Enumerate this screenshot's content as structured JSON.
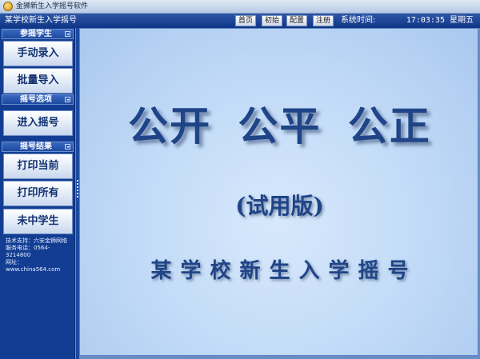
{
  "window": {
    "title": "金狮新生入学摇号软件",
    "icon": "app-logo-icon"
  },
  "header": {
    "app_title": "某学校新生入学摇号",
    "nav": [
      {
        "label": "首页"
      },
      {
        "label": "初始"
      },
      {
        "label": "配置"
      },
      {
        "label": "注册"
      }
    ],
    "system_time_label": "系统时间:",
    "clock": "17:03:35 星期五"
  },
  "sidebar": {
    "sections": [
      {
        "title": "参摇学生",
        "items": [
          {
            "label": "手动录入"
          },
          {
            "label": "批量导入"
          }
        ]
      },
      {
        "title": "摇号选项",
        "items": [
          {
            "label": "进入摇号"
          }
        ]
      },
      {
        "title": "摇号结果",
        "items": [
          {
            "label": "打印当前"
          },
          {
            "label": "打印所有"
          },
          {
            "label": "未中学生"
          }
        ]
      }
    ],
    "support": {
      "tech": "技术支持：六安金狮网络",
      "phone": "服务电话：0564-3214800",
      "site": "网址：www.china564.com"
    }
  },
  "main": {
    "slogan": "公开 公平 公正",
    "edition": "(试用版)",
    "subtitle": "某学校新生入学摇号"
  },
  "colors": {
    "header_bg": "#1f47a0",
    "sidebar_bg": "#123d92",
    "main_bg": "#c4dcf8",
    "text_blue": "#1f4487"
  }
}
